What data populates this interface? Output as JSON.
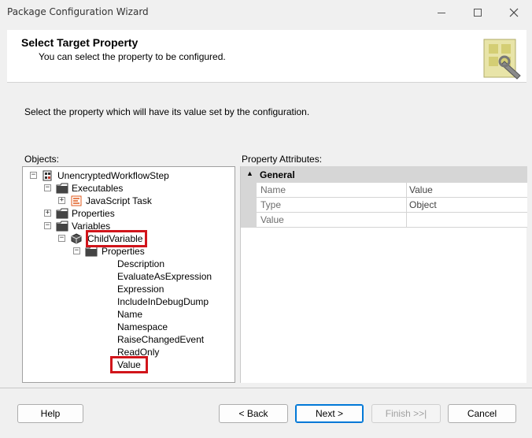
{
  "window": {
    "title": "Package Configuration Wizard"
  },
  "header": {
    "title": "Select Target Property",
    "subtitle": "You can select the property to be configured."
  },
  "instruction": "Select the property which will have its value set by the configuration.",
  "objects_label": "Objects:",
  "property_attributes_label": "Property Attributes:",
  "tree": {
    "root": "UnencryptedWorkflowStep",
    "executables": "Executables",
    "javascript_task": "JavaScript Task",
    "properties": "Properties",
    "variables": "Variables",
    "child_variable": "ChildVariable",
    "child_properties": "Properties",
    "leaf_items": [
      "Description",
      "EvaluateAsExpression",
      "Expression",
      "IncludeInDebugDump",
      "Name",
      "Namespace",
      "RaiseChangedEvent",
      "ReadOnly",
      "Value"
    ]
  },
  "grid": {
    "category": "General",
    "rows": [
      {
        "name": "Name",
        "value": "Value"
      },
      {
        "name": "Type",
        "value": "Object"
      },
      {
        "name": "Value",
        "value": ""
      }
    ]
  },
  "buttons": {
    "help": "Help",
    "back": "< Back",
    "next": "Next >",
    "finish": "Finish >>|",
    "cancel": "Cancel"
  },
  "colors": {
    "highlight_box": "#d1151b",
    "default_button_border": "#0078d7"
  },
  "icons": {
    "minimize": "minimize-icon",
    "maximize": "maximize-icon",
    "close": "close-icon",
    "wizard": "wizard-logo-icon",
    "package": "package-icon",
    "folder": "folder-icon",
    "task": "script-task-icon",
    "variable": "variable-icon"
  }
}
